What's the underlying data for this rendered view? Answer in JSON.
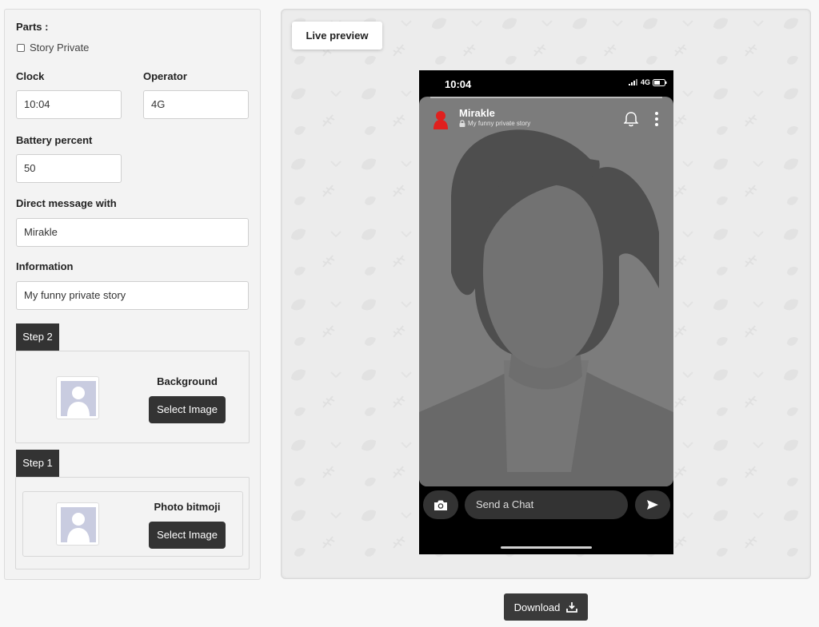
{
  "form": {
    "parts_label": "Parts :",
    "story_private_label": "Story Private",
    "clock_label": "Clock",
    "clock_value": "10:04",
    "operator_label": "Operator",
    "operator_value": "4G",
    "battery_label": "Battery percent",
    "battery_value": "50",
    "dm_label": "Direct message with",
    "dm_value": "Mirakle",
    "info_label": "Information",
    "info_value": "My funny private story"
  },
  "steps": [
    {
      "tab": "Step 2",
      "title": "Background",
      "button": "Select Image"
    },
    {
      "tab": "Step 1",
      "title": "Photo bitmoji",
      "button": "Select Image"
    }
  ],
  "preview": {
    "live_label": "Live preview",
    "phone": {
      "time": "10:04",
      "operator": "4G",
      "name": "Mirakle",
      "info": "My funny private story",
      "chat_placeholder": "Send a Chat"
    }
  },
  "download_label": "Download",
  "colors": {
    "dark_button": "#333333",
    "phone_background": "#000000",
    "story_background": "#7c7c7c",
    "avatar_red": "#e0201e"
  }
}
